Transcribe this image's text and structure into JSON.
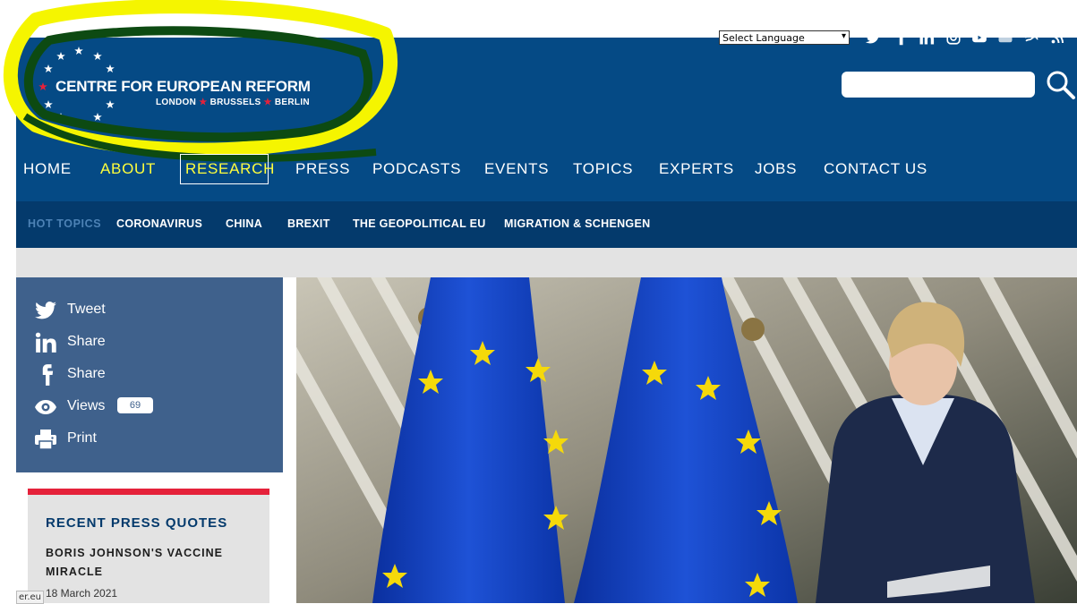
{
  "topbar": {
    "language_select": "Select Language",
    "social_icons": [
      "twitter-icon",
      "facebook-icon",
      "linkedin-icon",
      "instagram-icon",
      "youtube-icon",
      "flickr-icon",
      "soundcloud-icon",
      "rss-icon"
    ]
  },
  "logo": {
    "name": "CENTRE FOR EUROPEAN REFORM",
    "cities": [
      "LONDON",
      "BRUSSELS",
      "BERLIN"
    ]
  },
  "search": {
    "placeholder": ""
  },
  "nav": {
    "items": [
      {
        "label": "HOME"
      },
      {
        "label": "ABOUT"
      },
      {
        "label": "RESEARCH"
      },
      {
        "label": "PRESS"
      },
      {
        "label": "PODCASTS"
      },
      {
        "label": "EVENTS"
      },
      {
        "label": "TOPICS"
      },
      {
        "label": "EXPERTS"
      },
      {
        "label": "JOBS"
      },
      {
        "label": "CONTACT US"
      }
    ]
  },
  "hot_topics": {
    "label": "HOT TOPICS",
    "items": [
      "CORONAVIRUS",
      "CHINA",
      "BREXIT",
      "THE GEOPOLITICAL EU",
      "MIGRATION & SCHENGEN"
    ]
  },
  "share": {
    "tweet": "Tweet",
    "linkedin": "Share",
    "facebook": "Share",
    "views_label": "Views",
    "views_count": "69",
    "print": "Print"
  },
  "press_quotes": {
    "title": "RECENT PRESS QUOTES",
    "headline": "BORIS JOHNSON'S VACCINE MIRACLE",
    "date": "18 March 2021"
  },
  "statusbar": {
    "text": "er.eu"
  },
  "colors": {
    "header_blue": "#054a85",
    "hot_bar_blue": "#043a6c",
    "share_panel": "#3f618c",
    "nav_highlight": "#ffff3c",
    "accent_red": "#e5213a",
    "annotation_yellow": "#f5f500",
    "annotation_green": "#0d4a12"
  }
}
